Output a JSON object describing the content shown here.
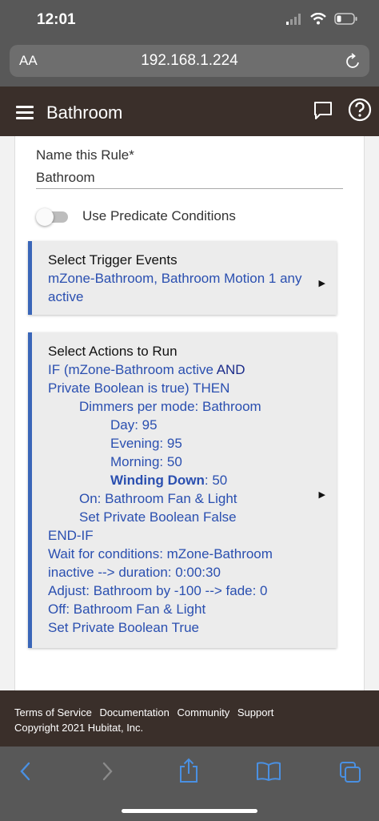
{
  "status": {
    "time": "12:01"
  },
  "browser": {
    "aa_label": "AA",
    "url": "192.168.1.224"
  },
  "header": {
    "title": "Bathroom"
  },
  "form": {
    "name_label": "Name this Rule*",
    "name_value": "Bathroom",
    "toggle_label": "Use Predicate Conditions",
    "toggle_on": false
  },
  "trigger": {
    "title": "Select Trigger Events",
    "lines": [
      "mZone-Bathroom, Bathroom Motion 1 any",
      "active"
    ]
  },
  "actions": {
    "title": "Select Actions to Run",
    "if_line_a": "IF (mZone-Bathroom active ",
    "if_line_and": "AND",
    "if_line_b": "Private Boolean is true) THEN",
    "dimmers": "Dimmers per mode: Bathroom",
    "day": "Day: 95",
    "evening": "Evening: 95",
    "morning": "Morning: 50",
    "winding_label": "Winding Down",
    "winding_value": ": 50",
    "on": "On: Bathroom Fan & Light",
    "set_false": "Set Private Boolean False",
    "end_if": "END-IF",
    "wait_a": "Wait for conditions: mZone-Bathroom",
    "wait_b": "inactive  --> duration: 0:00:30",
    "adjust": "Adjust: Bathroom by -100 --> fade: 0",
    "off": "Off: Bathroom Fan & Light",
    "set_true": "Set Private Boolean True"
  },
  "footer": {
    "links": [
      "Terms of Service",
      "Documentation",
      "Community",
      "Support"
    ],
    "copyright": "Copyright 2021 Hubitat, Inc."
  },
  "colors": {
    "header_bg": "#3a2f2a",
    "accent_blue": "#3a66b8",
    "text_blue": "#2a4fb0",
    "safari_icon_blue": "#4a90e2"
  }
}
